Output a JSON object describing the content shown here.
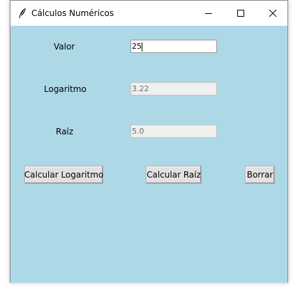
{
  "window": {
    "title": "Cálculos Numéricos",
    "controls": {
      "minimize": "minimize-icon",
      "maximize": "maximize-icon",
      "close": "close-icon"
    }
  },
  "form": {
    "valor_label": "Valor",
    "valor_value": "25",
    "logaritmo_label": "Logaritmo",
    "logaritmo_value": "3.22",
    "raiz_label": "Raíz",
    "raiz_value": "5.0"
  },
  "buttons": {
    "calc_log": "Calcular Logaritmo",
    "calc_raiz": "Calcular Raíz",
    "borrar": "Borrar"
  },
  "colors": {
    "background": "#add8e6",
    "button": "#e1e1e1"
  }
}
